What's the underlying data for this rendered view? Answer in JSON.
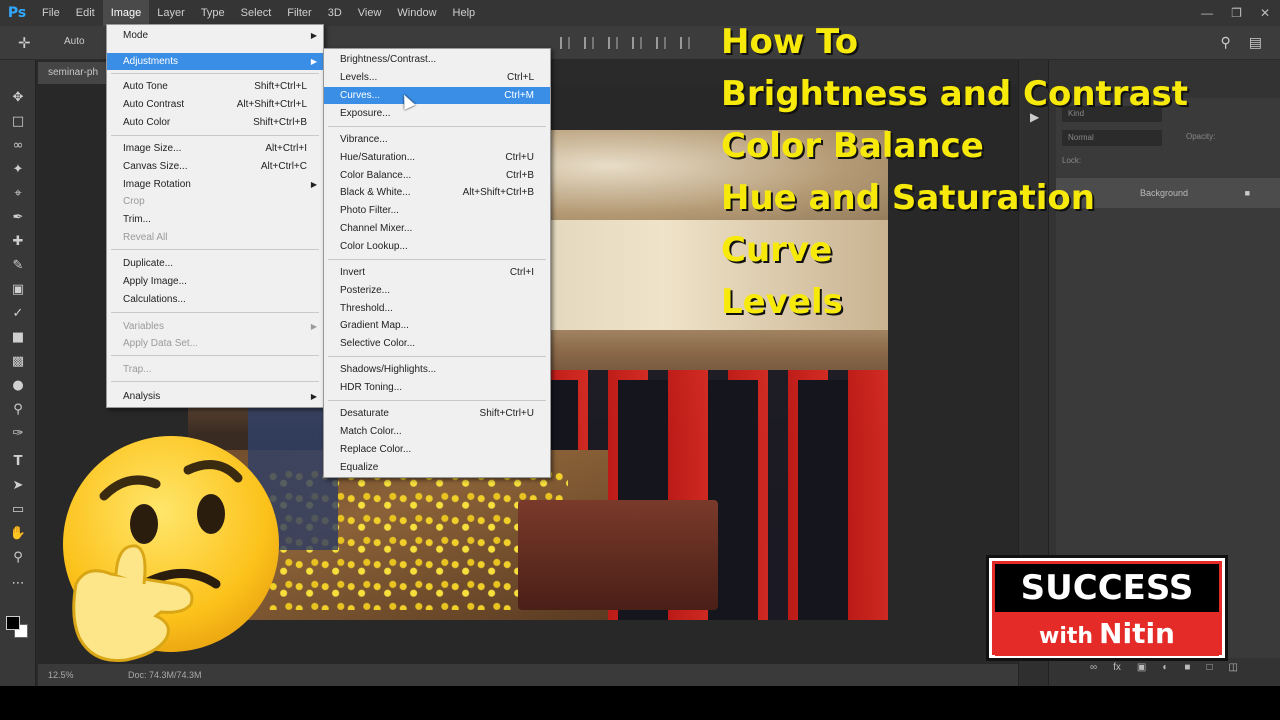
{
  "app": {
    "logo_text": "Ps",
    "menus": [
      "File",
      "Edit",
      "Image",
      "Layer",
      "Type",
      "Select",
      "Filter",
      "3D",
      "View",
      "Window",
      "Help"
    ],
    "active_menu": "Image",
    "options_auto_label": "Auto",
    "doc_tab_title": "seminar-ph",
    "zoom": "12.5%",
    "doc_info": "Doc: 74.3M/74.3M",
    "layers": {
      "kind_label": "Kind",
      "mode_label": "Normal",
      "opacity_label": "Opacity:",
      "lock_label": "Lock:",
      "layer_name": "Background"
    }
  },
  "image_menu": {
    "items": [
      {
        "label": "Mode",
        "shortcut": "",
        "submenu": true,
        "disabled": false
      },
      {
        "label": "Adjustments",
        "shortcut": "",
        "submenu": true,
        "disabled": false,
        "highlight": true
      },
      {
        "label": "Auto Tone",
        "shortcut": "Shift+Ctrl+L"
      },
      {
        "label": "Auto Contrast",
        "shortcut": "Alt+Shift+Ctrl+L"
      },
      {
        "label": "Auto Color",
        "shortcut": "Shift+Ctrl+B"
      },
      {
        "label": "Image Size...",
        "shortcut": "Alt+Ctrl+I"
      },
      {
        "label": "Canvas Size...",
        "shortcut": "Alt+Ctrl+C"
      },
      {
        "label": "Image Rotation",
        "shortcut": "",
        "submenu": true
      },
      {
        "label": "Crop",
        "shortcut": "",
        "disabled": true
      },
      {
        "label": "Trim...",
        "shortcut": ""
      },
      {
        "label": "Reveal All",
        "shortcut": "",
        "disabled": true
      },
      {
        "label": "Duplicate...",
        "shortcut": ""
      },
      {
        "label": "Apply Image...",
        "shortcut": ""
      },
      {
        "label": "Calculations...",
        "shortcut": ""
      },
      {
        "label": "Variables",
        "shortcut": "",
        "submenu": true,
        "disabled": true
      },
      {
        "label": "Apply Data Set...",
        "shortcut": "",
        "disabled": true
      },
      {
        "label": "Trap...",
        "shortcut": "",
        "disabled": true
      },
      {
        "label": "Analysis",
        "shortcut": "",
        "submenu": true
      }
    ]
  },
  "adjustments_menu": {
    "items": [
      {
        "label": "Brightness/Contrast...",
        "shortcut": ""
      },
      {
        "label": "Levels...",
        "shortcut": "Ctrl+L"
      },
      {
        "label": "Curves...",
        "shortcut": "Ctrl+M",
        "highlight": true
      },
      {
        "label": "Exposure...",
        "shortcut": ""
      },
      {
        "label": "Vibrance...",
        "shortcut": ""
      },
      {
        "label": "Hue/Saturation...",
        "shortcut": "Ctrl+U"
      },
      {
        "label": "Color Balance...",
        "shortcut": "Ctrl+B"
      },
      {
        "label": "Black & White...",
        "shortcut": "Alt+Shift+Ctrl+B"
      },
      {
        "label": "Photo Filter...",
        "shortcut": ""
      },
      {
        "label": "Channel Mixer...",
        "shortcut": ""
      },
      {
        "label": "Color Lookup...",
        "shortcut": ""
      },
      {
        "label": "Invert",
        "shortcut": "Ctrl+I"
      },
      {
        "label": "Posterize...",
        "shortcut": ""
      },
      {
        "label": "Threshold...",
        "shortcut": ""
      },
      {
        "label": "Gradient Map...",
        "shortcut": ""
      },
      {
        "label": "Selective Color...",
        "shortcut": ""
      },
      {
        "label": "Shadows/Highlights...",
        "shortcut": ""
      },
      {
        "label": "HDR Toning...",
        "shortcut": ""
      },
      {
        "label": "Desaturate",
        "shortcut": "Shift+Ctrl+U"
      },
      {
        "label": "Match Color...",
        "shortcut": ""
      },
      {
        "label": "Replace Color...",
        "shortcut": ""
      },
      {
        "label": "Equalize",
        "shortcut": ""
      }
    ]
  },
  "overlay": {
    "lines": [
      "How To",
      "Brightness and Contrast",
      "Color Balance",
      "Hue and Saturation",
      "Curve",
      "Levels"
    ],
    "color": "#f7ea0b"
  },
  "logo": {
    "top": "SUCCESS",
    "with": "with",
    "name": "Nitin",
    "accent": "#e52b27"
  },
  "icons": {
    "emoji": "thinking-face-icon"
  }
}
